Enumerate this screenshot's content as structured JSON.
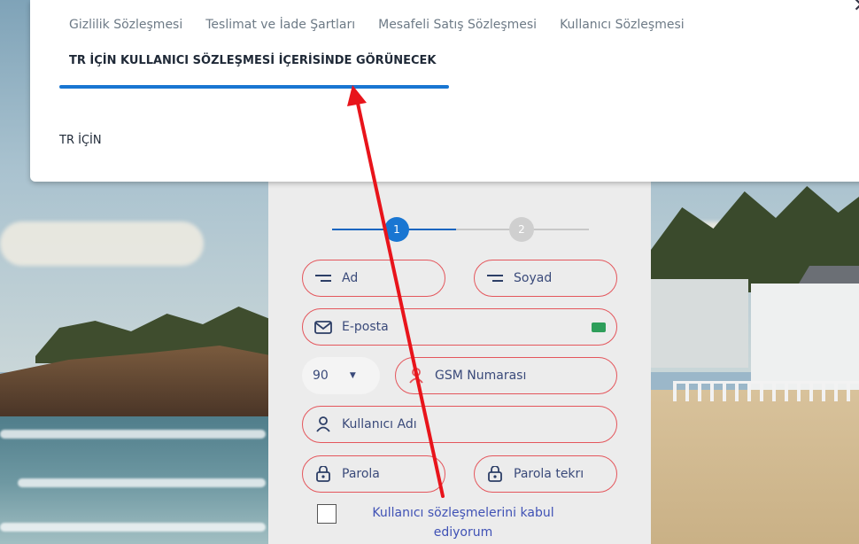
{
  "modal": {
    "tabs": [
      "Gizlilik Sözleşmesi",
      "Teslimat ve İade Şartları",
      "Mesafeli Satış Sözleşmesi",
      "Kullanıcı Sözleşmesi"
    ],
    "active_tab_label": "TR İÇİN KULLANICI SÖZLEŞMESİ İÇERİSİNDE GÖRÜNECEK",
    "body_text": "TR İÇİN",
    "close_icon": "close-icon"
  },
  "form": {
    "steps": [
      "1",
      "2"
    ],
    "first_name_placeholder": "Ad",
    "last_name_placeholder": "Soyad",
    "email_placeholder": "E-posta",
    "country_code": "90",
    "gsm_placeholder": "GSM Numarası",
    "username_placeholder": "Kullanıcı Adı",
    "password_placeholder": "Parola",
    "password_repeat_placeholder": "Parola tekrı",
    "consent_text": "Kullanıcı sözleşmelerini kabul ediyorum"
  },
  "colors": {
    "accent": "#1976d2",
    "field_border": "#e4565c",
    "annotation_arrow": "#e8141b"
  }
}
